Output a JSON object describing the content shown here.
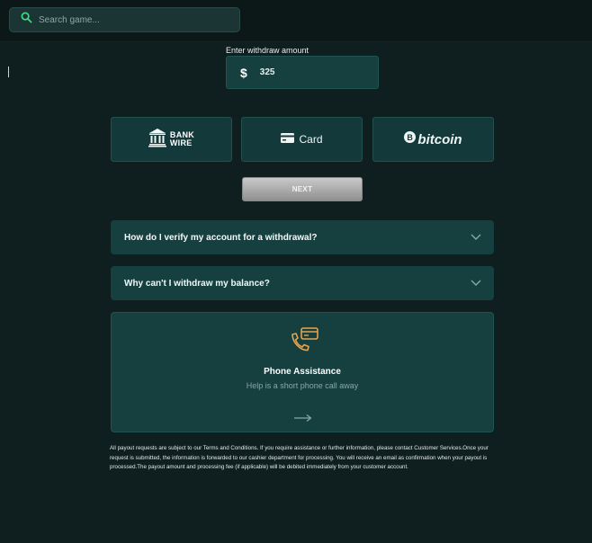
{
  "search": {
    "placeholder": "Search game..."
  },
  "withdraw": {
    "label": "Enter withdraw amount",
    "currency_symbol": "$",
    "amount": "325"
  },
  "methods": [
    {
      "id": "bank-wire",
      "label_line1": "BANK",
      "label_line2": "WIRE",
      "icon": "bank-icon"
    },
    {
      "id": "card",
      "label": "Card",
      "icon": "credit-card-icon"
    },
    {
      "id": "bitcoin",
      "label": "bitcoin",
      "icon": "bitcoin-icon"
    }
  ],
  "next_label": "NEXT",
  "faq": [
    {
      "question": "How do I verify my account for a withdrawal?"
    },
    {
      "question": "Why can't I withdraw my balance?"
    }
  ],
  "phone_assistance": {
    "title": "Phone Assistance",
    "subtitle": "Help is a short phone call away"
  },
  "disclaimer": "All payout requests are subject to our Terms and Conditions. If you require assistance or further information, please contact Customer Services.Once your request is submitted, the information is forwarded to our cashier department for processing. You will receive an email as confirmation when your payout is processed.The payout amount and processing fee (if applicable) will be debited immediately from your customer account.",
  "colors": {
    "background": "#0f1e1e",
    "panel": "#15403f",
    "accent_green": "#3ddc84",
    "accent_orange": "#e8a24a"
  }
}
